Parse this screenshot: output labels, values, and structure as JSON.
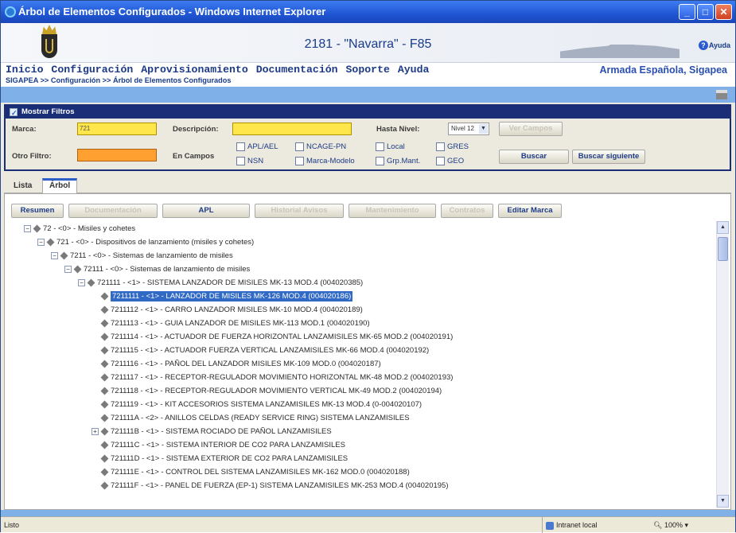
{
  "window": {
    "title": "Árbol de Elementos Configurados - Windows Internet Explorer"
  },
  "banner": {
    "ship_title": "2181 - \"Navarra\" - F85",
    "help_label": "Ayuda"
  },
  "menu": {
    "items": [
      "Inicio",
      "Configuración",
      "Aprovisionamiento",
      "Documentación",
      "Soporte",
      "Ayuda"
    ],
    "organization": "Armada Española, Sigapea",
    "breadcrumb": "SIGAPEA >> Configuración >> Árbol de Elementos Configurados"
  },
  "filters": {
    "header": "Mostrar Filtros",
    "marca_label": "Marca:",
    "marca_value": "721",
    "descripcion_label": "Descripción:",
    "descripcion_value": "",
    "hasta_nivel_label": "Hasta Nivel:",
    "nivel_value": "Nivel 12",
    "ver_campos_label": "Ver Campos",
    "otro_filtro_label": "Otro Filtro:",
    "en_campos_label": "En Campos",
    "checkboxes": [
      "APL/AEL",
      "NSN",
      "NCAGE-PN",
      "Marca-Modelo",
      "Local",
      "Grp.Mant.",
      "GRES",
      "GEO"
    ],
    "buscar_label": "Buscar",
    "buscar_siguiente_label": "Buscar siguiente"
  },
  "tabs": [
    "Lista",
    "Árbol"
  ],
  "toolbar": {
    "buttons": [
      "Resumen",
      "Documentación",
      "APL",
      "Historial Avisos",
      "Mantenimiento",
      "Contratos",
      "Editar Marca"
    ]
  },
  "tree": [
    {
      "text": "72 - <0> - Misiles y cohetes",
      "level": 0,
      "expander": "−"
    },
    {
      "text": "721 - <0> - Dispositivos de lanzamiento (misiles y cohetes)",
      "level": 1,
      "expander": "−"
    },
    {
      "text": "7211 - <0> - Sistemas de lanzamiento de misiles",
      "level": 2,
      "expander": "−"
    },
    {
      "text": "72111 - <0> - Sistemas de lanzamiento de misiles",
      "level": 3,
      "expander": "−"
    },
    {
      "text": "721111 - <1> - SISTEMA LANZADOR DE MISILES MK-13 MOD.4 (004020385)",
      "level": 4,
      "expander": "−"
    },
    {
      "text": "7211111 - <1> - LANZADOR DE MISILES MK-126 MOD.4 (004020186)",
      "level": 5,
      "expander": "",
      "selected": true
    },
    {
      "text": "7211112 - <1> - CARRO LANZADOR MISILES MK-10 MOD.4 (004020189)",
      "level": 5,
      "expander": ""
    },
    {
      "text": "7211113 - <1> - GUIA LANZADOR DE MISILES MK-113 MOD.1 (004020190)",
      "level": 5,
      "expander": ""
    },
    {
      "text": "7211114 - <1> - ACTUADOR DE FUERZA HORIZONTAL LANZAMISILES MK-65 MOD.2 (004020191)",
      "level": 5,
      "expander": ""
    },
    {
      "text": "7211115 - <1> - ACTUADOR FUERZA VERTICAL LANZAMISILES MK-66 MOD.4 (004020192)",
      "level": 5,
      "expander": ""
    },
    {
      "text": "7211116 - <1> - PAÑOL DEL LANZADOR MISILES MK-109 MOD.0 (004020187)",
      "level": 5,
      "expander": ""
    },
    {
      "text": "7211117 - <1> - RECEPTOR-REGULADOR MOVIMIENTO HORIZONTAL MK-48 MOD.2 (004020193)",
      "level": 5,
      "expander": ""
    },
    {
      "text": "7211118 - <1> - RECEPTOR-REGULADOR MOVIMIENTO VERTICAL MK-49 MOD.2 (004020194)",
      "level": 5,
      "expander": ""
    },
    {
      "text": "7211119 - <1> - KIT ACCESORIOS SISTEMA LANZAMISILES MK-13 MOD.4 (0-004020107)",
      "level": 5,
      "expander": ""
    },
    {
      "text": "721111A - <2> - ANILLOS CELDAS (READY SERVICE RING) SISTEMA LANZAMISILES",
      "level": 5,
      "expander": ""
    },
    {
      "text": "721111B - <1> - SISTEMA ROCIADO DE PAÑOL LANZAMISILES",
      "level": 5,
      "expander": "+"
    },
    {
      "text": "721111C - <1> - SISTEMA INTERIOR DE CO2 PARA LANZAMISILES",
      "level": 5,
      "expander": ""
    },
    {
      "text": "721111D - <1> - SISTEMA EXTERIOR DE CO2 PARA LANZAMISILES",
      "level": 5,
      "expander": ""
    },
    {
      "text": "721111E - <1> - CONTROL DEL SISTEMA LANZAMISILES MK-162 MOD.0 (004020188)",
      "level": 5,
      "expander": ""
    },
    {
      "text": "721111F - <1> - PANEL DE FUERZA (EP-1) SISTEMA LANZAMISILES MK-253 MOD.4 (004020195)",
      "level": 5,
      "expander": ""
    }
  ],
  "status": {
    "left": "Listo",
    "zone": "Intranet local",
    "zoom": "100%"
  }
}
